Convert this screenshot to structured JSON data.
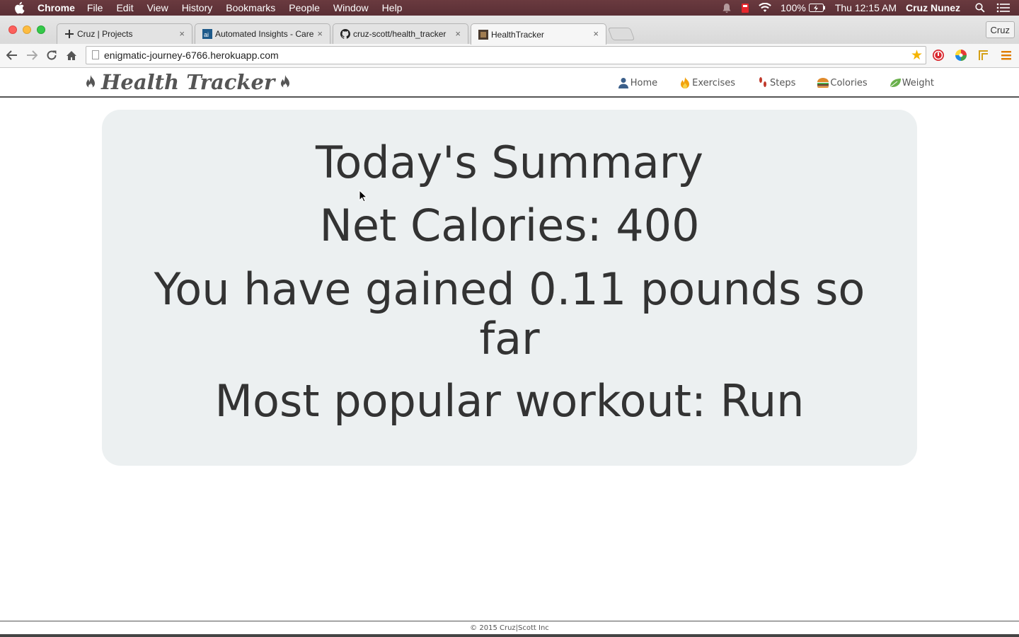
{
  "menubar": {
    "app": "Chrome",
    "items": [
      "File",
      "Edit",
      "View",
      "History",
      "Bookmarks",
      "People",
      "Window",
      "Help"
    ],
    "battery": "100%",
    "clock": "Thu 12:15 AM",
    "user": "Cruz Nunez"
  },
  "tabs": [
    {
      "title": "Cruz | Projects",
      "icon": "plus-icon"
    },
    {
      "title": "Automated Insights - Care",
      "icon": "ai-logo-icon"
    },
    {
      "title": "cruz-scott/health_tracker",
      "icon": "github-icon"
    },
    {
      "title": "HealthTracker",
      "icon": "site-favicon",
      "active": true
    }
  ],
  "profile": "Cruz",
  "address": {
    "url": "enigmatic-journey-6766.herokuapp.com"
  },
  "site": {
    "brand": "Health Tracker",
    "nav": [
      {
        "label": "Home",
        "icon": "person-icon"
      },
      {
        "label": "Exercises",
        "icon": "fire-icon"
      },
      {
        "label": "Steps",
        "icon": "footprints-icon"
      },
      {
        "label": "Colories",
        "icon": "burger-icon"
      },
      {
        "label": "Weight",
        "icon": "leaf-icon"
      }
    ]
  },
  "summary": {
    "title": "Today's Summary",
    "net_calories": "Net Calories: 400",
    "gain": "You have gained 0.11 pounds so far",
    "workout": "Most popular workout: Run"
  },
  "footer": {
    "text": "© 2015 Cruz|Scott Inc"
  },
  "colors": {
    "menubar": "#5a2f35",
    "card": "#ecf0f1",
    "text": "#333333",
    "star": "#f5b400"
  }
}
